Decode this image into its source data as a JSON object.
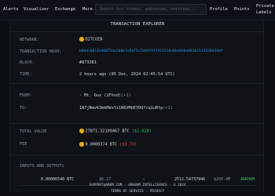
{
  "nav": {
    "items": [
      "Alerts",
      "Visualizer",
      "Exchange",
      "More",
      "Profile",
      "Points"
    ],
    "search_placeholder": "Search for tokens, addresses, entities...",
    "private_labels": "Private\nLabels"
  },
  "panel_title": "TRANSACTION EXPLORER",
  "network": {
    "label": "NETWORK:",
    "value": "BITCOIN"
  },
  "tx_hash": {
    "label": "TRANSACTION HASH:",
    "value": "b8bdc0014346875da2b8e7e5af5c7b94f6ff4f2318a6be64ba061b2133338434df"
  },
  "block": {
    "label": "BLOCK:",
    "value": "#873381"
  },
  "time": {
    "label": "TIME:",
    "value": "2 hours ago",
    "detail": "(05 Dec, 2024 02:45:54 UTC)"
  },
  "from": {
    "label": "FROM:",
    "value": "Mt. Gox (1Fhsd)",
    "extra": "(+1)"
  },
  "to": {
    "label": "TO:",
    "value": "1N7jNmv63mkMdsYz1N6VMbEYDQfcq1uBfp",
    "extra": "(+1)"
  },
  "total_value": {
    "label": "TOTAL VALUE",
    "btc": "27871.32109467 BTC",
    "usd": "($2.62B)"
  },
  "fee": {
    "label": "FEE",
    "btc": "0.0000374 BTC",
    "usd": "($3.70)"
  },
  "inputs_outputs": {
    "label": "INPUTS AND OUTPUTS",
    "items": [
      "0.00006546 BTC",
      "$6.17",
      "→",
      "2512.54737946",
      "$209.4M",
      "ARKHAM"
    ]
  },
  "footer": {
    "line1": "SUPPORT@ARKM.COM - ARKHAM INTELLIGENCE - © 2024",
    "line2": "TERMS OF SERVICE - PRIVACY"
  },
  "colors": {
    "accent_link": "#3a8fd9",
    "bitcoin": "#f2a900",
    "positive": "#3fb66a",
    "negative": "#d65454"
  }
}
